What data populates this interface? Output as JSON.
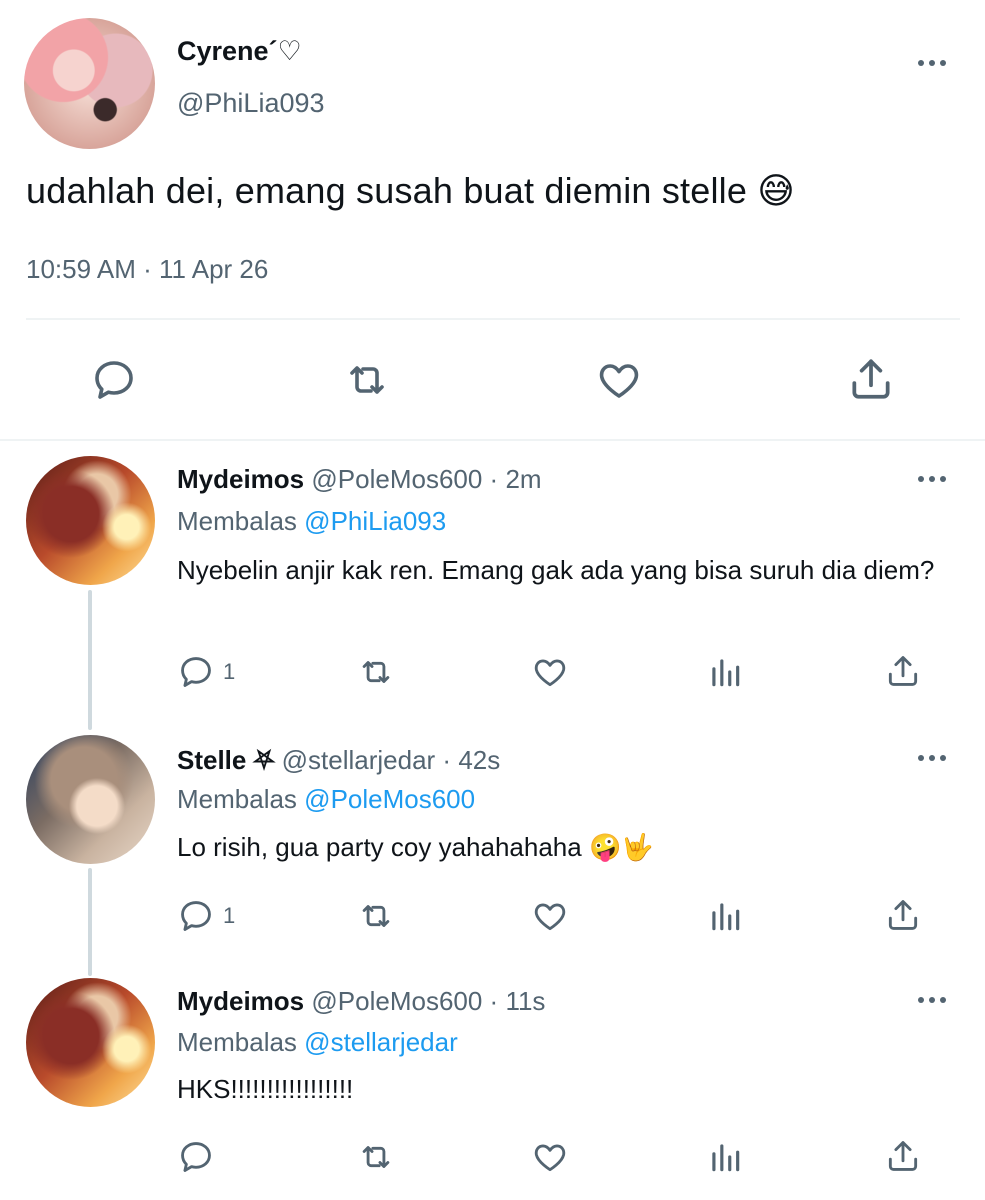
{
  "main_tweet": {
    "author_name": "Cyrene´♡",
    "author_handle": "@PhiLia093",
    "text": "udahlah dei, emang susah buat diemin stelle 😅",
    "time": "10:59 AM",
    "separator": " · ",
    "date": "11 Apr 26"
  },
  "replies": [
    {
      "author_name": "Mydeimos",
      "author_handle": "@PoleMos600",
      "time": "2m",
      "replying_label": "Membalas",
      "replying_to": "@PhiLia093",
      "text": "Nyebelin anjir kak ren. Emang gak ada yang bisa suruh dia diem?",
      "reply_count": "1"
    },
    {
      "author_name": "Stelle ⛧",
      "author_handle": "@stellarjedar",
      "time": "42s",
      "replying_label": "Membalas",
      "replying_to": "@PoleMos600",
      "text": "Lo risih, gua party coy yahahahaha 🤪🤟",
      "reply_count": "1"
    },
    {
      "author_name": "Mydeimos",
      "author_handle": "@PoleMos600",
      "time": "11s",
      "replying_label": "Membalas",
      "replying_to": "@stellarjedar",
      "text": "HKS!!!!!!!!!!!!!!!!!",
      "reply_count": ""
    }
  ],
  "colors": {
    "text": "#0f1419",
    "secondary": "#536471",
    "mention": "#1d9bf0",
    "divider": "#eff3f4",
    "thread_line": "#cfd9de"
  },
  "icons": [
    "reply-icon",
    "retweet-icon",
    "like-icon",
    "views-icon",
    "share-icon",
    "more-icon"
  ]
}
